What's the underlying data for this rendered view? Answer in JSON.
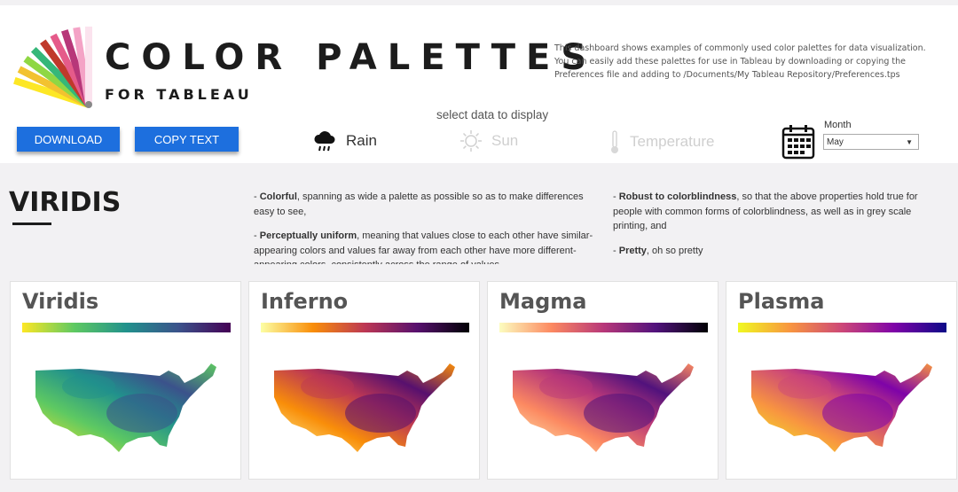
{
  "header": {
    "title": "COLOR PALETTES",
    "subtitle": "FOR TABLEAU",
    "description": "This dashboard shows examples of commonly used color palettes for data visualization. You can easily add these palettes for use in Tableau by downloading or copying the Preferences file and adding to /Documents/My Tableau Repository/Preferences.tps"
  },
  "buttons": {
    "download": "DOWNLOAD",
    "copy": "COPY TEXT"
  },
  "data_select": {
    "label": "select data to display",
    "options": [
      {
        "label": "Rain",
        "icon": "rain-cloud-icon",
        "active": true
      },
      {
        "label": "Sun",
        "icon": "sun-icon",
        "active": false
      },
      {
        "label": "Temperature",
        "icon": "thermometer-icon",
        "active": false
      }
    ]
  },
  "month": {
    "label": "Month",
    "value": "May"
  },
  "section": {
    "title": "VIRIDIS",
    "bullets_left": [
      {
        "bold": "Colorful",
        "text": ", spanning as wide a palette as possible so as to make differences easy to see,"
      },
      {
        "bold": "Perceptually uniform",
        "text": ", meaning that values close to each other have similar-appearing colors and values far away from each other have more different-appearing colors, consistently across the range of values,"
      }
    ],
    "bullets_right": [
      {
        "bold": "Robust to colorblindness",
        "text": ", so that the above properties hold true for people with common forms of colorblindness, as well as in grey scale printing, and"
      },
      {
        "bold": "Pretty",
        "text": ", oh so pretty"
      }
    ]
  },
  "palettes": [
    {
      "name": "Viridis",
      "colors": [
        "#fde725",
        "#5ec962",
        "#21918c",
        "#3b528b",
        "#440154"
      ]
    },
    {
      "name": "Inferno",
      "colors": [
        "#fcffa4",
        "#f98e09",
        "#bc3754",
        "#57106e",
        "#000004"
      ]
    },
    {
      "name": "Magma",
      "colors": [
        "#fcfdbf",
        "#fc8961",
        "#b73779",
        "#51127c",
        "#000004"
      ]
    },
    {
      "name": "Plasma",
      "colors": [
        "#f0f921",
        "#f89540",
        "#cc4778",
        "#7e03a8",
        "#0d0887"
      ]
    }
  ]
}
